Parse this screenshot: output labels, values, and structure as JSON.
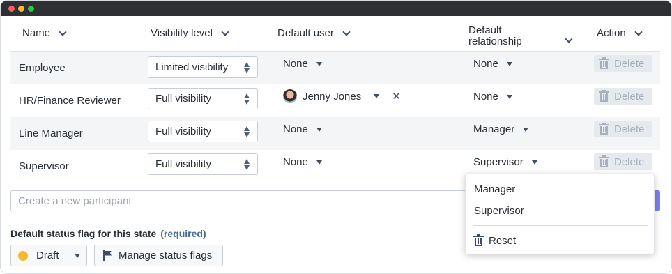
{
  "table": {
    "columns": [
      {
        "label": "Name"
      },
      {
        "label": "Visibility level"
      },
      {
        "label": "Default user"
      },
      {
        "label": "Default\nrelationship"
      },
      {
        "label": "Action"
      }
    ],
    "rows": [
      {
        "name": "Employee",
        "visibility": "Limited visibility",
        "default_user": "None",
        "relationship": "None",
        "action": "Delete"
      },
      {
        "name": "HR/Finance Reviewer",
        "visibility": "Full visibility",
        "default_user": "Jenny Jones",
        "relationship": "None",
        "action": "Delete"
      },
      {
        "name": "Line Manager",
        "visibility": "Full visibility",
        "default_user": "None",
        "relationship": "Manager",
        "action": "Delete"
      },
      {
        "name": "Supervisor",
        "visibility": "Full visibility",
        "default_user": "None",
        "relationship": "Supervisor",
        "action": "Delete"
      }
    ]
  },
  "new_participant": {
    "placeholder": "Create a new participant"
  },
  "status_flag": {
    "label": "Default status flag for this state",
    "required": "(required)",
    "selected": "Draft",
    "selected_color": "#f5b82e",
    "manage_label": "Manage status flags"
  },
  "relationship_menu": {
    "options": [
      "Manager",
      "Supervisor"
    ],
    "reset_label": "Reset"
  },
  "colors": {
    "accent": "#7b7ff0",
    "titlebar": "#2f3033",
    "alt_row": "#f3f5f7"
  }
}
